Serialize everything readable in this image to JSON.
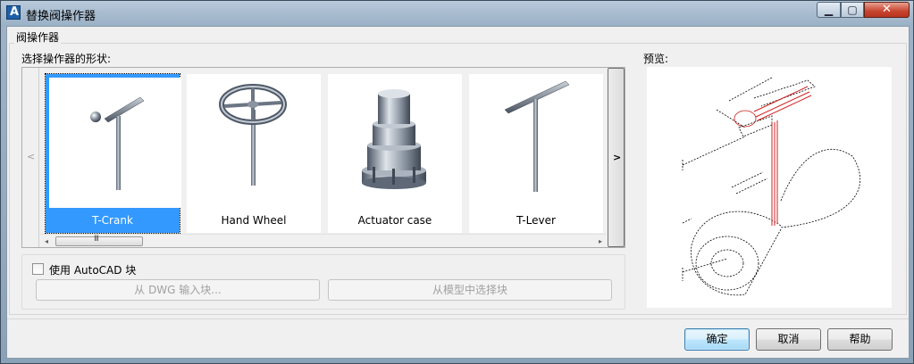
{
  "window": {
    "title": "替换阀操作器",
    "controls": {
      "minimize": "▁",
      "maximize": "▢",
      "close": "✕"
    }
  },
  "group": {
    "title": "阀操作器"
  },
  "gallery": {
    "label": "选择操作器的形状:",
    "nav_left": "<",
    "nav_right": ">",
    "items": [
      {
        "label": "T-Crank",
        "icon": "t-crank-icon",
        "selected": true
      },
      {
        "label": "Hand Wheel",
        "icon": "hand-wheel-icon",
        "selected": false
      },
      {
        "label": "Actuator case",
        "icon": "actuator-case-icon",
        "selected": false
      },
      {
        "label": "T-Lever",
        "icon": "t-lever-icon",
        "selected": false
      }
    ],
    "scroll": {
      "left": "◂",
      "right": "▸",
      "grip": "III"
    }
  },
  "preview": {
    "label": "预览:"
  },
  "autocad_block": {
    "checkbox_label": "使用 AutoCAD 块",
    "checked": false,
    "import_dwg_button": "从 DWG 输入块...",
    "select_model_button": "从模型中选择块"
  },
  "buttons": {
    "ok": "确定",
    "cancel": "取消",
    "help": "帮助"
  },
  "colors": {
    "selection": "#3399ff",
    "preview_red": "#d02020"
  }
}
